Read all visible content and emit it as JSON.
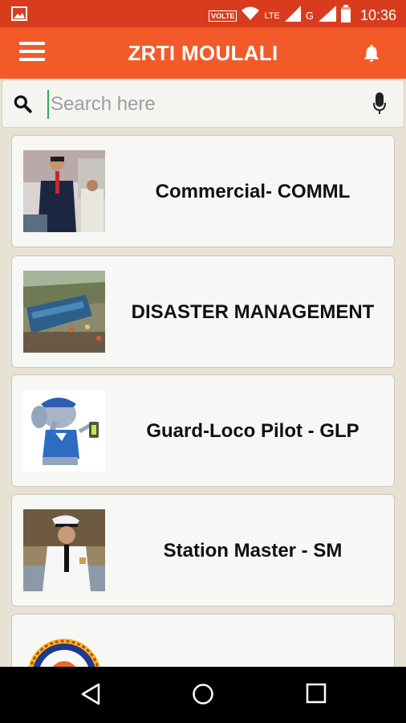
{
  "status_bar": {
    "volte": "VOLTE",
    "lte": "LTE",
    "g": "G",
    "r": "R",
    "time": "10:36"
  },
  "app_bar": {
    "title": "ZRTI MOULALI"
  },
  "search": {
    "placeholder": "Search here",
    "value": ""
  },
  "list": {
    "items": [
      {
        "label": "Commercial- COMML",
        "thumb": "photo-man-in-suit"
      },
      {
        "label": "DISASTER MANAGEMENT",
        "thumb": "photo-derailed-train"
      },
      {
        "label": "Guard-Loco Pilot - GLP",
        "thumb": "cartoon-elephant-with-lantern"
      },
      {
        "label": "Station Master - SM",
        "thumb": "photo-station-master"
      },
      {
        "label": "",
        "thumb": "zrti-logo"
      }
    ]
  },
  "colors": {
    "status_bar": "#d83c1d",
    "app_bar": "#f35a2a",
    "background": "#e8e2d4",
    "card": "#f7f7f5"
  },
  "icons": {
    "menu": "hamburger-icon",
    "bell": "bell-icon",
    "search": "search-icon",
    "mic": "mic-icon",
    "back": "back-icon",
    "home": "home-icon",
    "recents": "recents-icon"
  }
}
